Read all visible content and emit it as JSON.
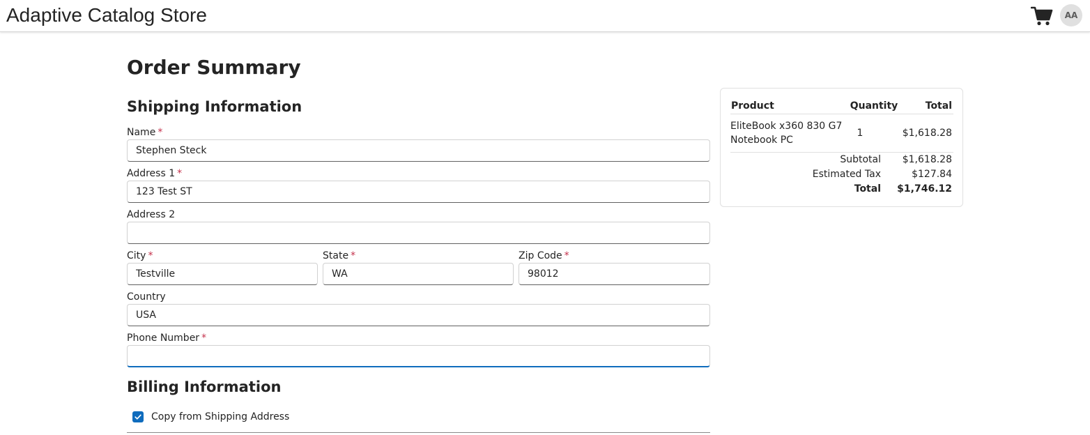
{
  "header": {
    "app_title": "Adaptive Catalog Store",
    "avatar_initials": "AA"
  },
  "page": {
    "title": "Order Summary"
  },
  "shipping": {
    "section_title": "Shipping Information",
    "required_mark": "*",
    "name": {
      "label": "Name",
      "value": "Stephen Steck",
      "required": true
    },
    "address1": {
      "label": "Address 1",
      "value": "123 Test ST",
      "required": true
    },
    "address2": {
      "label": "Address 2",
      "value": "",
      "required": false
    },
    "city": {
      "label": "City",
      "value": "Testville",
      "required": true
    },
    "state": {
      "label": "State",
      "value": "WA",
      "required": true
    },
    "zip": {
      "label": "Zip Code",
      "value": "98012",
      "required": true
    },
    "country": {
      "label": "Country",
      "value": "USA",
      "required": false
    },
    "phone": {
      "label": "Phone Number",
      "value": "",
      "required": true
    }
  },
  "billing": {
    "section_title": "Billing Information",
    "copy_label": "Copy from Shipping Address",
    "copy_checked": true
  },
  "summary": {
    "headers": {
      "product": "Product",
      "quantity": "Quantity",
      "total": "Total"
    },
    "items": [
      {
        "product_line1": "EliteBook x360 830 G7",
        "product_line2": "Notebook PC",
        "quantity": "1",
        "total": "$1,618.28"
      }
    ],
    "subtotal_label": "Subtotal",
    "subtotal_value": "$1,618.28",
    "tax_label": "Estimated Tax",
    "tax_value": "$127.84",
    "total_label": "Total",
    "total_value": "$1,746.12"
  },
  "colors": {
    "accent": "#0f6cbd",
    "required": "#c4314b",
    "text": "#242424"
  }
}
